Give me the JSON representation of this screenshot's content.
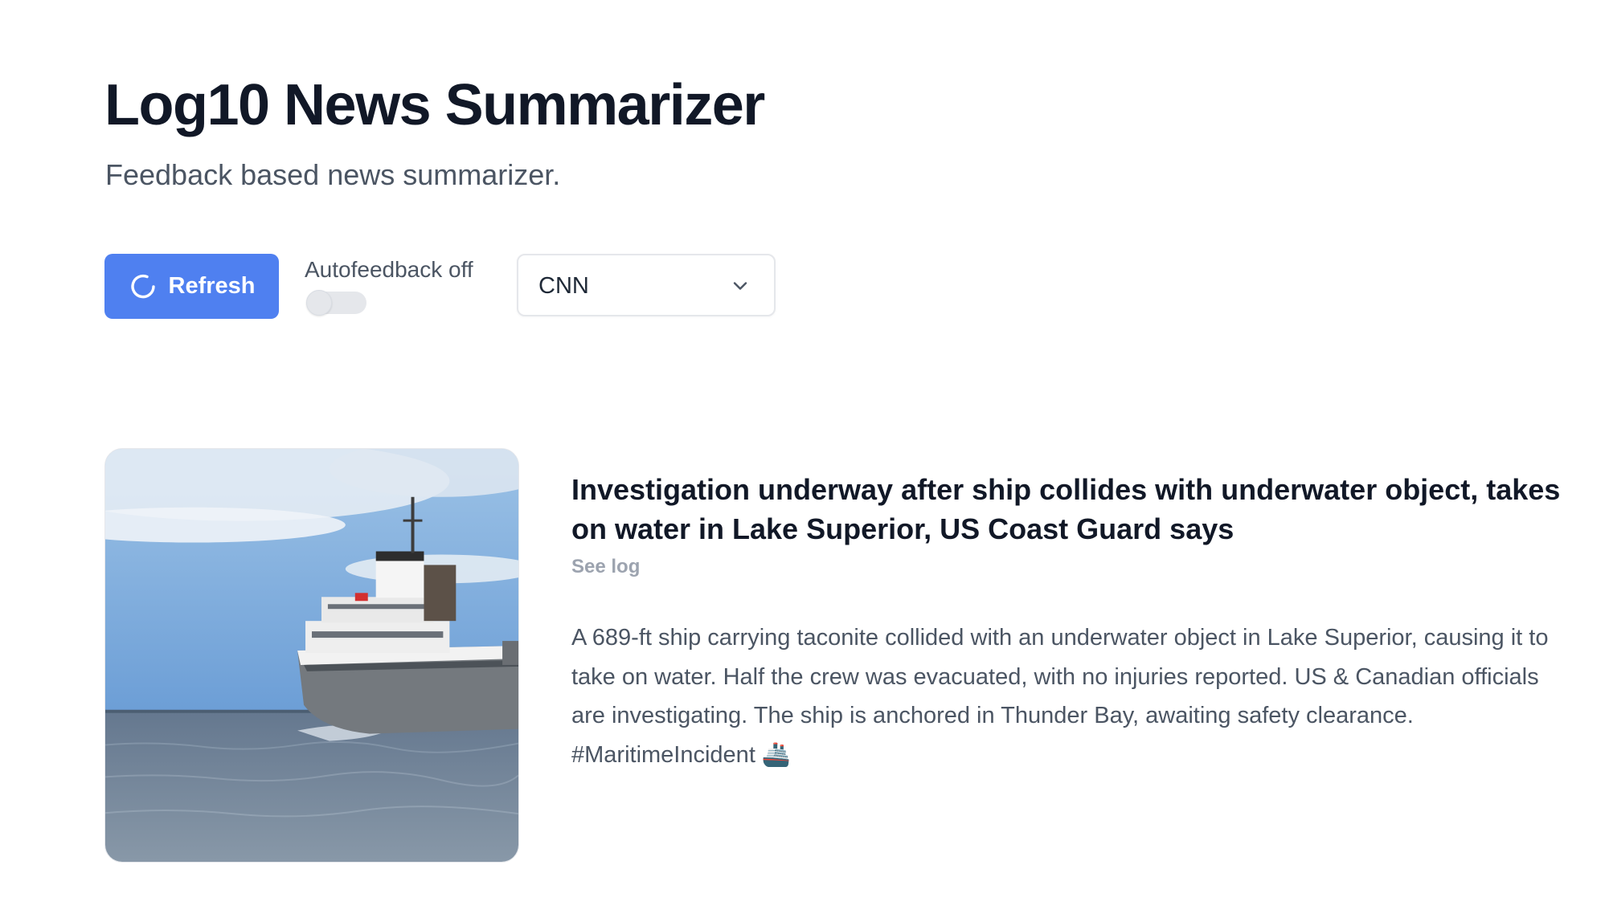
{
  "header": {
    "title": "Log10 News Summarizer",
    "subtitle": "Feedback based news summarizer."
  },
  "toolbar": {
    "refresh_label": "Refresh",
    "autofeedback_label": "Autofeedback off",
    "autofeedback_enabled": false,
    "source_selected": "CNN"
  },
  "colors": {
    "accent": "#4f80f0",
    "heading": "#111827",
    "muted_text": "#4b5563",
    "see_log": "#9ca3af"
  },
  "articles": [
    {
      "headline": "Investigation underway after ship collides with underwater object, takes on water in Lake Superior, US Coast Guard says",
      "see_log_label": "See log",
      "summary": "A 689-ft ship carrying taconite collided with an underwater object in Lake Superior, causing it to take on water. Half the crew was evacuated, with no injuries reported. US & Canadian officials are investigating. The ship is anchored in Thunder Bay, awaiting safety clearance. #MaritimeIncident 🚢"
    }
  ]
}
